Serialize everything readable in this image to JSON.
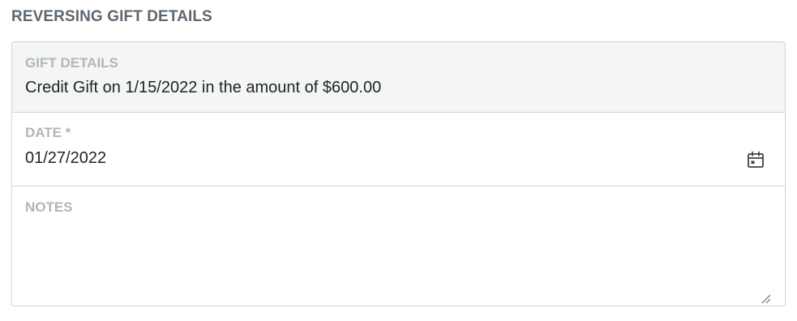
{
  "section": {
    "title": "REVERSING GIFT DETAILS"
  },
  "gift_details": {
    "label": "GIFT DETAILS",
    "value": "Credit Gift on 1/15/2022 in the amount of $600.00"
  },
  "date_field": {
    "label": "DATE *",
    "value": "01/27/2022",
    "icon": "calendar-icon"
  },
  "notes_field": {
    "label": "NOTES",
    "value": ""
  },
  "colors": {
    "title_text": "#5d6770",
    "label_text": "#b3b6b9",
    "value_text": "#1f2326",
    "readonly_background": "#f4f5f5",
    "border": "#cfd3d6"
  }
}
